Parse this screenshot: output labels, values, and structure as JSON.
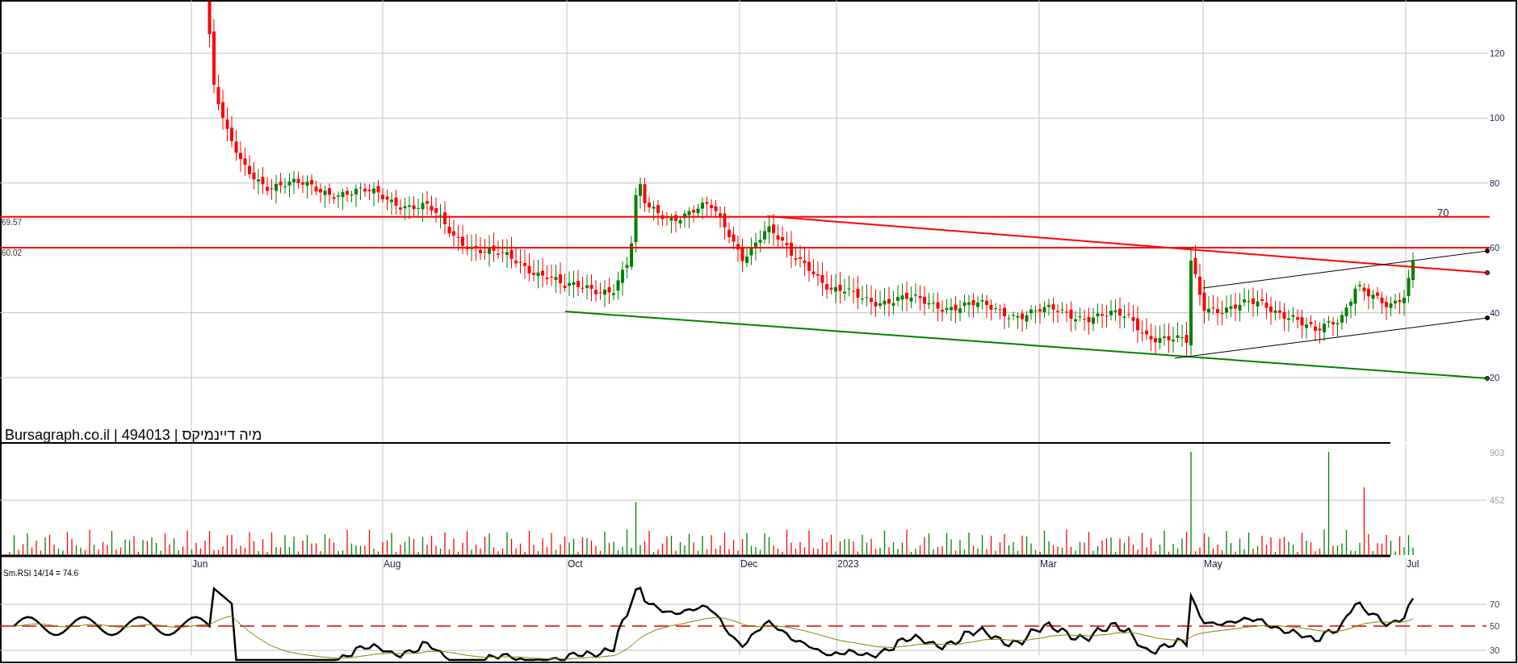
{
  "price_panel": {
    "title": "Bursagraph.co.il | 494013 | מיה דיינמיקס",
    "y_axis_labels": [
      "120",
      "100",
      "80",
      "60",
      "40",
      "20"
    ],
    "levels": [
      {
        "label": "69.57"
      },
      {
        "label": "60.02"
      }
    ],
    "target_label": "70"
  },
  "volume_panel": {
    "y_axis_labels": [
      "903",
      "452"
    ]
  },
  "x_axis_labels": [
    "Jun",
    "Aug",
    "Oct",
    "Dec",
    "2023",
    "Mar",
    "May",
    "Jul"
  ],
  "rsi_panel": {
    "legend": "Sm.RSI 14/14 = 74.6",
    "y_axis_labels": [
      "70",
      "50",
      "30"
    ]
  }
}
